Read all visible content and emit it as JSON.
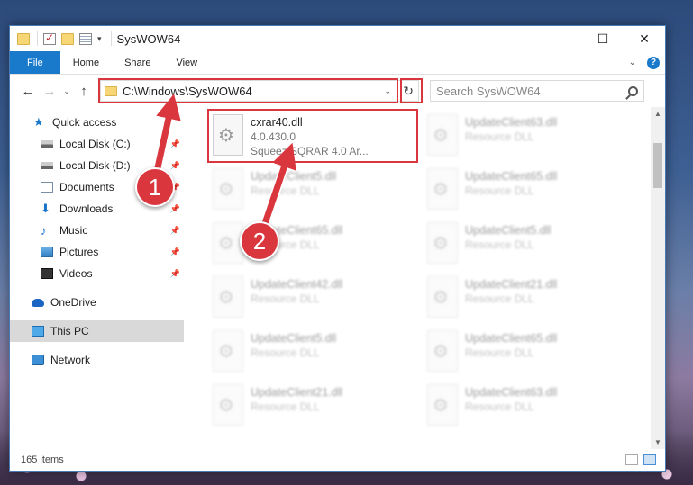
{
  "window": {
    "title": "SysWOW64",
    "controls": {
      "minimize": "—",
      "maximize": "☐",
      "close": "✕"
    }
  },
  "ribbon": {
    "tabs": [
      "File",
      "Home",
      "Share",
      "View"
    ],
    "help": "?"
  },
  "address_bar": {
    "path": "C:\\Windows\\SysWOW64",
    "refresh_icon": "↻"
  },
  "search": {
    "placeholder": "Search SysWOW64"
  },
  "navigation": {
    "quick_access": "Quick access",
    "items": [
      {
        "label": "Local Disk (C:)",
        "icon": "disk-icon"
      },
      {
        "label": "Local Disk (D:)",
        "icon": "disk-icon"
      },
      {
        "label": "Documents",
        "icon": "documents-icon"
      },
      {
        "label": "Downloads",
        "icon": "downloads-icon"
      },
      {
        "label": "Music",
        "icon": "music-icon"
      },
      {
        "label": "Pictures",
        "icon": "pictures-icon"
      },
      {
        "label": "Videos",
        "icon": "videos-icon"
      }
    ],
    "onedrive": "OneDrive",
    "this_pc": "This PC",
    "network": "Network"
  },
  "files": [
    {
      "name": "cxrar40.dll",
      "version": "4.0.430.0",
      "description": "Squeez SQRAR 4.0 Ar..."
    },
    {
      "name": "UpdateClient63.dll",
      "description": "Resource DLL"
    },
    {
      "name": "UpdateClient5.dll",
      "description": "Resource DLL"
    },
    {
      "name": "UpdateClient65.dll",
      "description": "Resource DLL"
    },
    {
      "name": "UpdateClient65.dll",
      "description": "Resource DLL"
    },
    {
      "name": "UpdateClient5.dll",
      "description": "Resource DLL"
    },
    {
      "name": "UpdateClient42.dll",
      "description": "Resource DLL"
    },
    {
      "name": "UpdateClient21.dll",
      "description": "Resource DLL"
    },
    {
      "name": "UpdateClient5.dll",
      "description": "Resource DLL"
    },
    {
      "name": "UpdateClient65.dll",
      "description": "Resource DLL"
    },
    {
      "name": "UpdateClient21.dll",
      "description": "Resource DLL"
    },
    {
      "name": "UpdateClient63.dll",
      "description": "Resource DLL"
    }
  ],
  "status": {
    "item_count": "165 items"
  },
  "annotations": {
    "step1": "1",
    "step2": "2",
    "color": "#d9363e"
  }
}
